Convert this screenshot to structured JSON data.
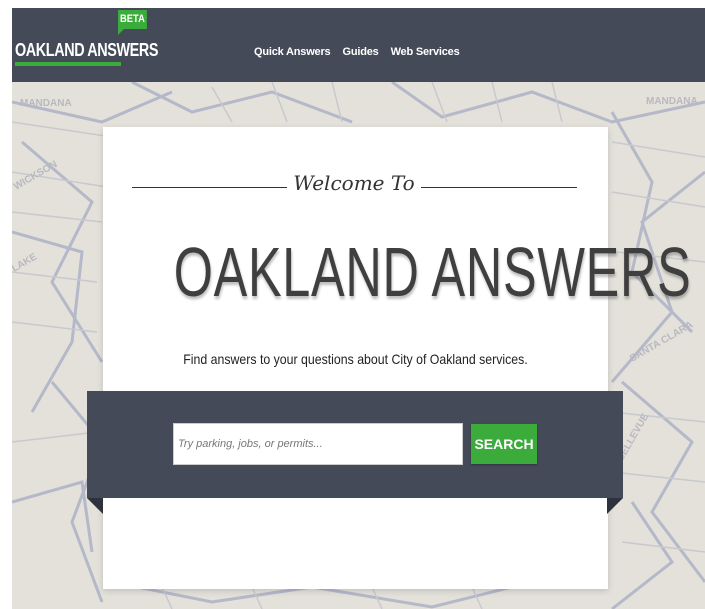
{
  "header": {
    "badge": "BETA",
    "logo": "OAKLAND ANSWERS",
    "nav": [
      {
        "label": "Quick Answers"
      },
      {
        "label": "Guides"
      },
      {
        "label": "Web Services"
      }
    ]
  },
  "hero": {
    "welcome": "Welcome To",
    "title": "OAKLAND ANSWERS",
    "subtitle": "Find answers to your questions about City of Oakland services."
  },
  "search": {
    "placeholder": "Try parking, jobs, or permits...",
    "value": "",
    "button_label": "SEARCH"
  },
  "colors": {
    "header_bg": "#444a58",
    "accent_green": "#3bab3b",
    "map_bg": "#e3e1da"
  }
}
